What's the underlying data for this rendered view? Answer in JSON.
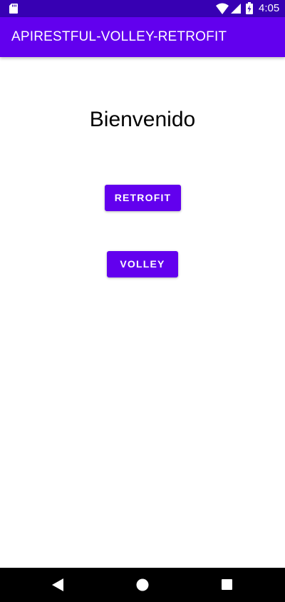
{
  "status_bar": {
    "time": "4:05",
    "icons": [
      "sd-card-icon",
      "wifi-icon",
      "signal-icon",
      "battery-charging-icon"
    ]
  },
  "app_bar": {
    "title": "APIRESTFUL-VOLLEY-RETROFIT"
  },
  "main": {
    "welcome": "Bienvenido",
    "retrofit_button": "RETROFIT",
    "volley_button": "VOLLEY"
  },
  "nav_bar": {
    "icons": [
      "back-icon",
      "home-icon",
      "recents-icon"
    ]
  },
  "colors": {
    "status_bar": "#3700b3",
    "primary": "#6200ee",
    "background": "#ffffff",
    "nav_bar": "#000000"
  }
}
